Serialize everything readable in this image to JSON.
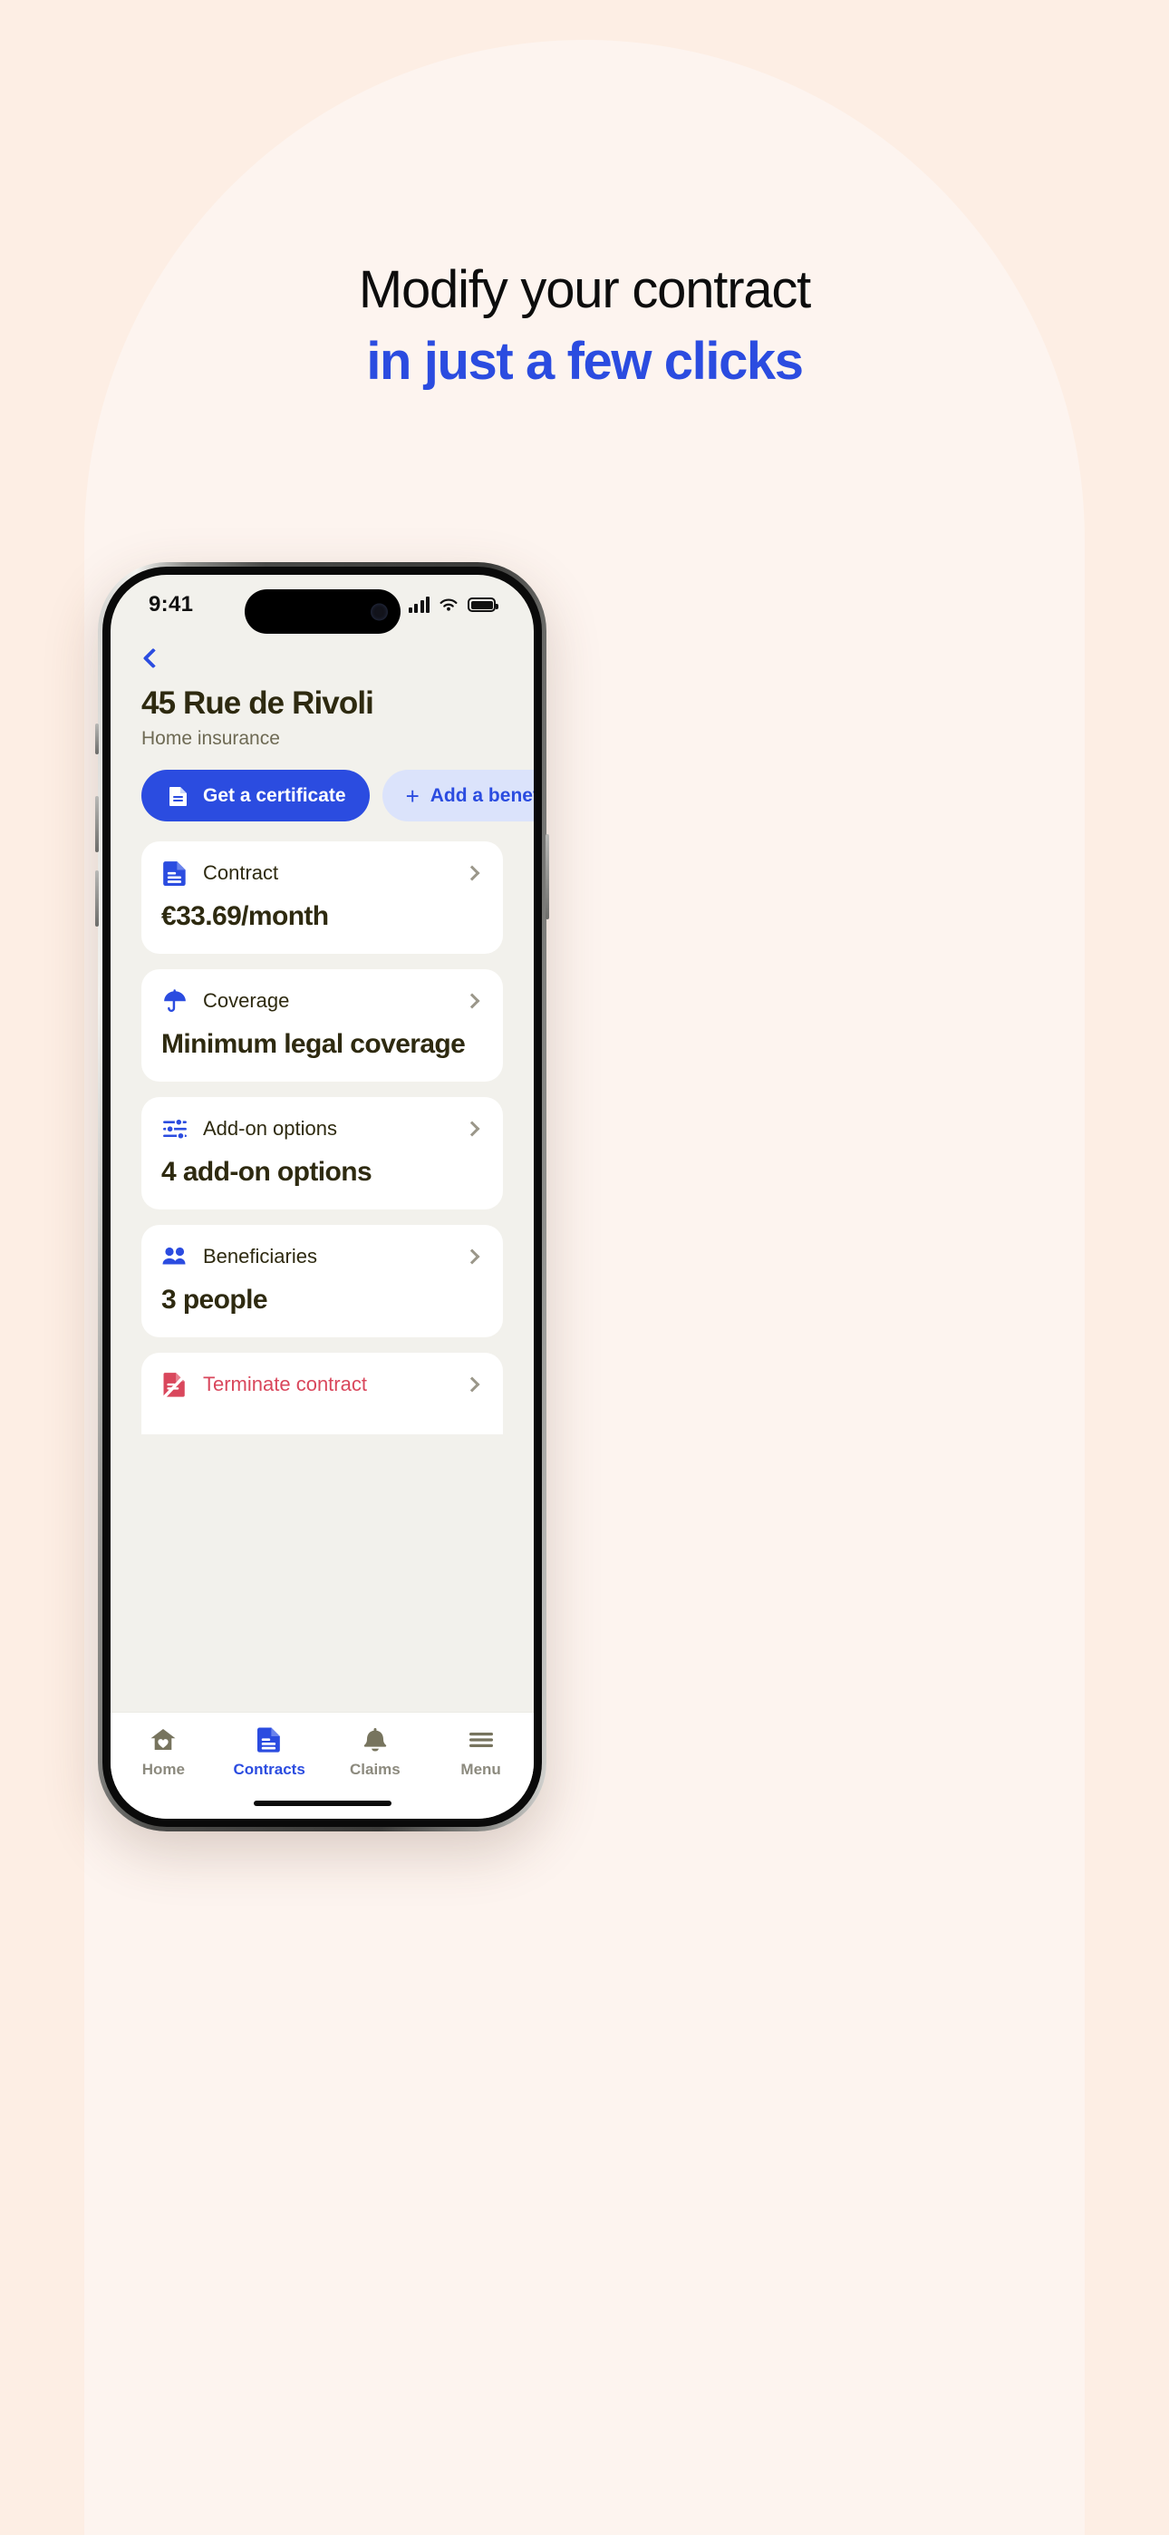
{
  "theme": {
    "background": "#fdeee4",
    "arch": "#fdf4ef",
    "brand_blue": "#2b4ce0",
    "chip_blue_soft": "#dbe3fb",
    "ink": "#2e2a10",
    "muted": "#6e6a54",
    "danger": "#d9475c",
    "screen_bg": "#f2f1ec",
    "card_bg": "#ffffff"
  },
  "promo": {
    "line1": "Modify your contract",
    "line2": "in just a few clicks"
  },
  "status_bar": {
    "time": "9:41",
    "signal_icon": "cellular-signal-icon",
    "wifi_icon": "wifi-icon",
    "battery_icon": "battery-full-icon"
  },
  "screen": {
    "back_icon": "chevron-left-icon",
    "title": "45 Rue de Rivoli",
    "subtitle": "Home insurance",
    "actions": [
      {
        "label": "Get a certificate",
        "icon": "document-icon",
        "style": "primary"
      },
      {
        "label": "Add a beneficiary",
        "icon": "plus-icon",
        "style": "secondary"
      }
    ],
    "cards": [
      {
        "label": "Contract",
        "value": "€33.69/month",
        "icon": "document-icon"
      },
      {
        "label": "Coverage",
        "value": "Minimum legal coverage",
        "icon": "umbrella-icon"
      },
      {
        "label": "Add-on options",
        "value": "4 add-on options",
        "icon": "sliders-icon"
      },
      {
        "label": "Beneficiaries",
        "value": "3 people",
        "icon": "people-icon"
      }
    ],
    "terminate": {
      "label": "Terminate contract",
      "icon": "document-cancel-icon"
    },
    "tabs": [
      {
        "label": "Home",
        "icon": "home-heart-icon",
        "active": false
      },
      {
        "label": "Contracts",
        "icon": "document-icon",
        "active": true
      },
      {
        "label": "Claims",
        "icon": "bell-icon",
        "active": false
      },
      {
        "label": "Menu",
        "icon": "hamburger-icon",
        "active": false
      }
    ]
  }
}
